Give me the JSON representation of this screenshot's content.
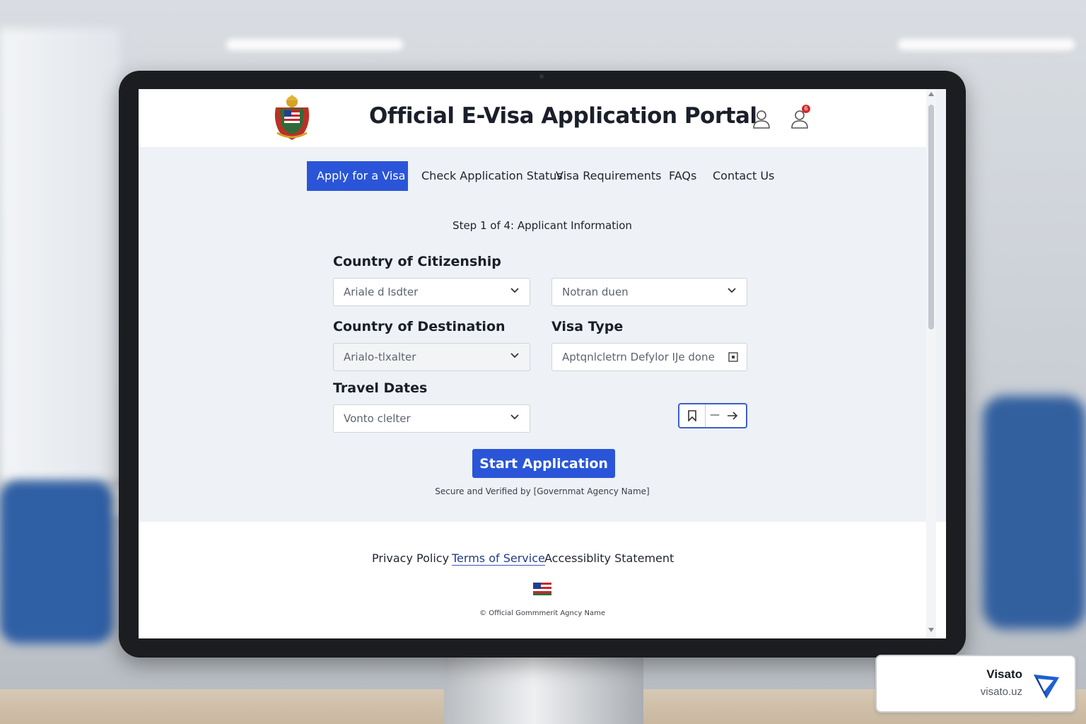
{
  "portal": {
    "title": "Official E-Visa Application Portal",
    "notification_count": "6"
  },
  "nav": {
    "items": [
      {
        "label": "Apply for a Visa"
      },
      {
        "label": "Check Application Status"
      },
      {
        "label": "Visa Requirements"
      },
      {
        "label": "FAQs"
      },
      {
        "label": "Contact Us"
      }
    ]
  },
  "form": {
    "step": "Step 1 of 4: Applicant Information",
    "citizenship": {
      "label": "Country of Citizenship",
      "value": "Ariale d Isdter",
      "second_value": "Notran duen"
    },
    "destination": {
      "label": "Country of Destination",
      "value": "Arialo-tlxalter"
    },
    "visa_type": {
      "label": "Visa Type",
      "value": "Aptqnlcletrn Defylor IJe done"
    },
    "travel_dates": {
      "label": "Travel Dates",
      "value": "Vonto clelter",
      "range_separator": "—"
    },
    "start_button": "Start Application",
    "secure_note": "Secure and Verified by [Governmat Agency Name]"
  },
  "footer": {
    "links": [
      {
        "label": "Privacy Policy"
      },
      {
        "label": "Terms of Service"
      },
      {
        "label": "Accessiblity Statement"
      }
    ],
    "copyright": "© Official Gommmerit Agncy Name"
  },
  "brand": {
    "name": "Visato",
    "url": "visato.uz"
  },
  "colors": {
    "primary": "#2a55d8",
    "badge": "#d42a2a"
  }
}
